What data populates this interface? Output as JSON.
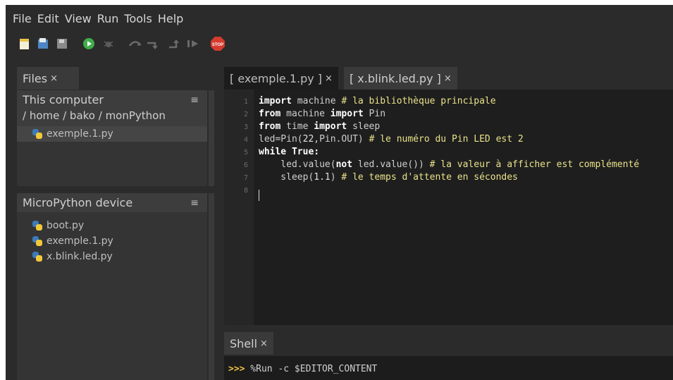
{
  "menu": [
    "File",
    "Edit",
    "View",
    "Run",
    "Tools",
    "Help"
  ],
  "toolbar": {
    "icons": [
      "new-file-icon",
      "open-file-icon",
      "save-file-icon",
      "run-icon",
      "debug-icon",
      "step-over-icon",
      "step-into-icon",
      "step-out-icon",
      "resume-icon",
      "stop-icon"
    ],
    "stop_label": "STOP"
  },
  "files_panel": {
    "tab_label": "Files",
    "tab_close": "×",
    "computer": {
      "title": "This computer",
      "path": "/ home / bako / monPython",
      "files": [
        "exemple.1.py"
      ]
    },
    "device": {
      "title": "MicroPython device",
      "files": [
        "boot.py",
        "exemple.1.py",
        "x.blink.led.py"
      ]
    },
    "menu_glyph": "≡"
  },
  "editor": {
    "tabs": [
      {
        "label": "[ exemple.1.py ]",
        "close": "×",
        "active": true
      },
      {
        "label": "[ x.blink.led.py ]",
        "close": "×",
        "active": false
      }
    ],
    "line_numbers": [
      "1",
      "2",
      "3",
      "4",
      "5",
      "6",
      "7",
      "8"
    ],
    "lines": [
      [
        {
          "t": "import",
          "c": "kw"
        },
        {
          "t": " machine ",
          "c": "id"
        },
        {
          "t": "# la bibliothèque principale",
          "c": "cm"
        }
      ],
      [
        {
          "t": "from",
          "c": "kw"
        },
        {
          "t": " machine ",
          "c": "id"
        },
        {
          "t": "import",
          "c": "kw"
        },
        {
          "t": " Pin",
          "c": "id"
        }
      ],
      [
        {
          "t": "from",
          "c": "kw"
        },
        {
          "t": " time ",
          "c": "id"
        },
        {
          "t": "import",
          "c": "kw"
        },
        {
          "t": " sleep",
          "c": "id"
        }
      ],
      [
        {
          "t": "led=Pin(",
          "c": "id"
        },
        {
          "t": "22",
          "c": "num"
        },
        {
          "t": ",Pin.OUT) ",
          "c": "id"
        },
        {
          "t": "# le numéro du Pin LED est 2",
          "c": "cm"
        }
      ],
      [
        {
          "t": "while",
          "c": "kw"
        },
        {
          "t": " True:",
          "c": "kw"
        }
      ],
      [
        {
          "t": "    led.value(",
          "c": "id"
        },
        {
          "t": "not",
          "c": "kw"
        },
        {
          "t": " led.value()) ",
          "c": "id"
        },
        {
          "t": "# la valeur à afficher est complémenté",
          "c": "cm"
        }
      ],
      [
        {
          "t": "    sleep(",
          "c": "id"
        },
        {
          "t": "1.1",
          "c": "num"
        },
        {
          "t": ") ",
          "c": "id"
        },
        {
          "t": "# le temps d'attente en sécondes",
          "c": "cm"
        }
      ],
      []
    ]
  },
  "shell": {
    "tab_label": "Shell",
    "tab_close": "×",
    "prompt": ">>>",
    "command": " %Run -c $EDITOR_CONTENT"
  }
}
